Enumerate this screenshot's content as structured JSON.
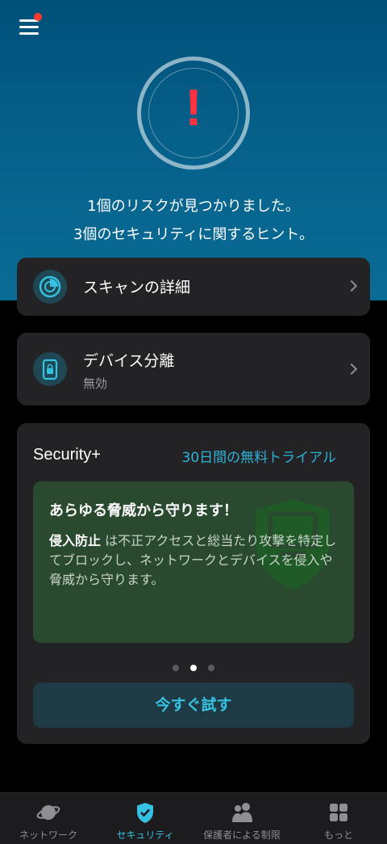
{
  "header": {
    "menu_icon": "hamburger-menu-icon",
    "notification_badge": "red-dot",
    "alert_symbol": "!",
    "risk_line": "1個のリスクが見つかりました。",
    "hint_line": "3個のセキュリティに関するヒント。"
  },
  "cards": {
    "scan": {
      "title": "スキャンの詳細",
      "icon": "scan-radar-icon"
    },
    "isolation": {
      "title": "デバイス分離",
      "status": "無効",
      "icon": "device-lock-icon"
    }
  },
  "promo": {
    "title": "Security+",
    "trial_link": "30日間の無料トライアル",
    "slide": {
      "heading": "あらゆる脅威から守ります！",
      "body_bold": "侵入防止",
      "body_text": " は不正アクセスと総当たり攻撃を特定してブロックし、ネットワークとデバイスを侵入や脅威から守ります。"
    },
    "carousel": {
      "count": 3,
      "active_index": 1
    },
    "cta": "今すぐ試す"
  },
  "tabbar": {
    "items": [
      {
        "label": "ネットワーク",
        "icon": "planet-icon"
      },
      {
        "label": "セキュリティ",
        "icon": "shield-check-icon"
      },
      {
        "label": "保護者による制限",
        "icon": "family-icon"
      },
      {
        "label": "もっと",
        "icon": "grid-icon"
      }
    ],
    "active_index": 1
  },
  "colors": {
    "accent": "#36c2e3",
    "alert": "#ff3340",
    "hero_top": "#005079",
    "card_bg": "#232326",
    "slide_bg": "#2a4a2f"
  }
}
